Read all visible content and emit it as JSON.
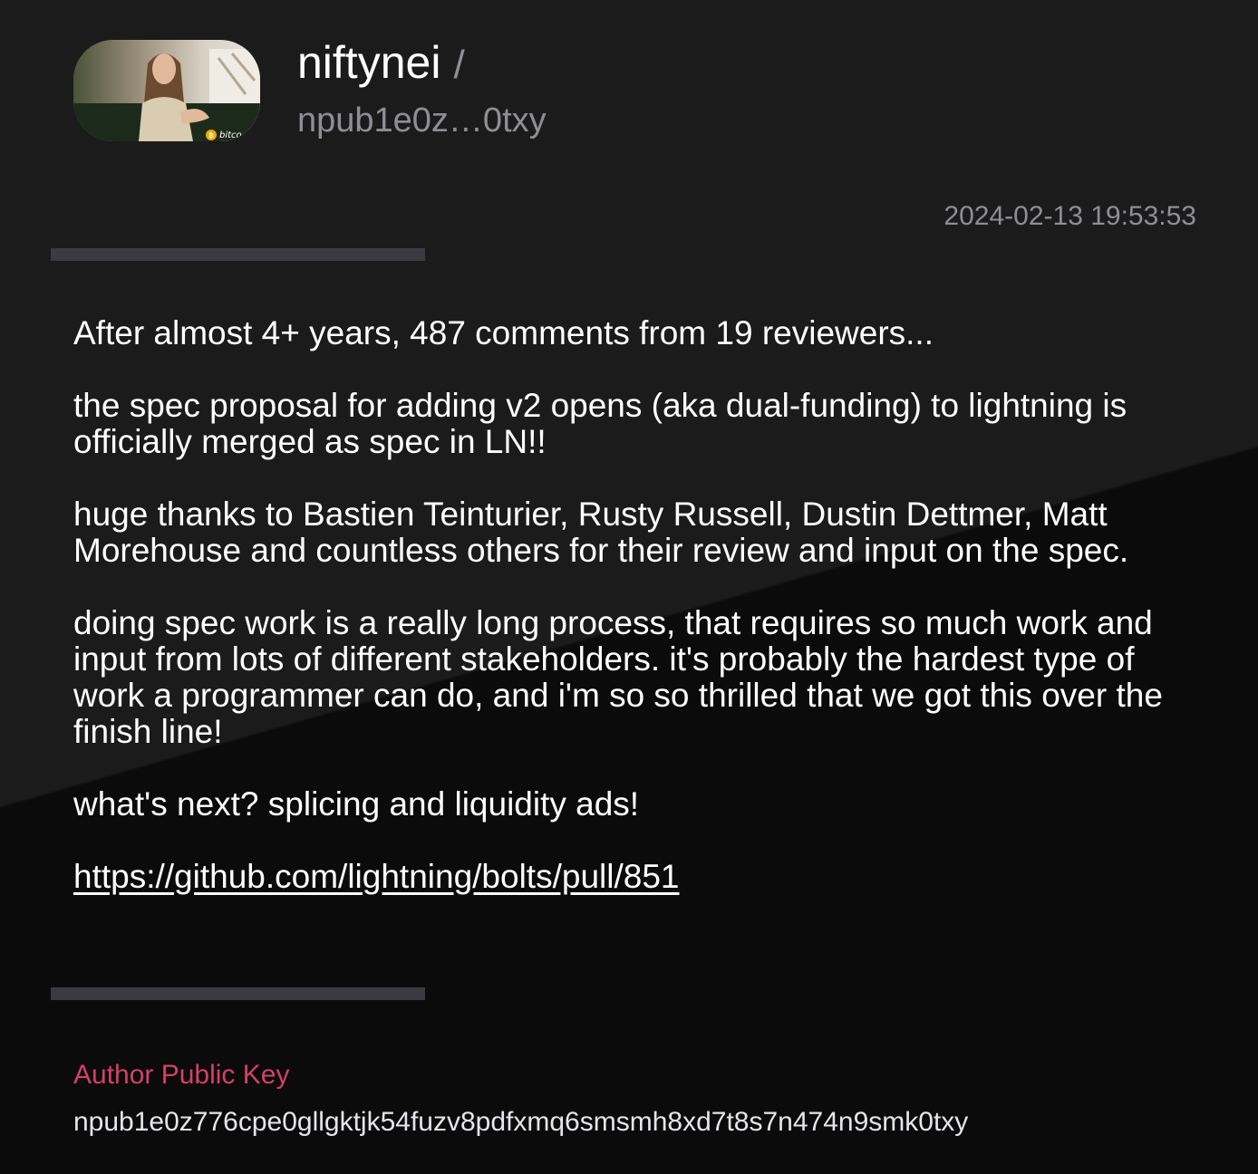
{
  "author": {
    "display_name": "niftynei",
    "separator": "/",
    "short_npub": "npub1e0z…0txy",
    "avatar_overlay_text": "bitco"
  },
  "note": {
    "timestamp": "2024-02-13 19:53:53",
    "paragraphs": [
      "After almost 4+ years, 487 comments from 19 reviewers...",
      "the spec proposal for adding v2 opens (aka dual-funding) to lightning is officially merged as spec in LN!!",
      "huge thanks to Bastien Teinturier, Rusty Russell, Dustin Dettmer, Matt Morehouse and countless others for their review and input on the spec.",
      "doing spec work is a really long process, that requires so much work and input from lots of different stakeholders. it's probably the hardest type of work a programmer can do, and i'm so so thrilled that we got this over the finish line!",
      "what's next? splicing and liquidity ads!"
    ],
    "link": "https://github.com/lightning/bolts/pull/851"
  },
  "author_key": {
    "label": "Author Public Key",
    "value": "npub1e0z776cpe0gllgktjk54fuzv8pdfxmq6smsmh8xd7t8s7n474n9smk0txy"
  },
  "colors": {
    "background_top": "#1b1b1c",
    "background_bottom": "#0b0b0b",
    "muted_text": "#8e8e93",
    "accent": "#d63f6c",
    "divider": "#3b3b3f"
  }
}
